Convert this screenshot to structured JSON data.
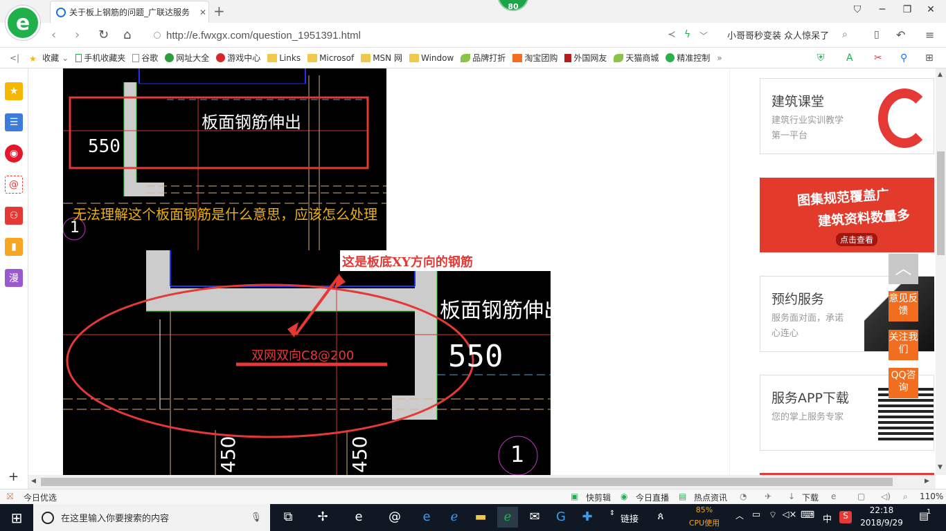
{
  "browser": {
    "tab_title": "关于板上钢筋的问题_广联达服务",
    "badge": "80",
    "url": "http://e.fwxgx.com/question_1951391.html",
    "search_hint": "小哥哥秒变装 众人惊呆了"
  },
  "bookmarks": [
    {
      "label": "收藏",
      "icon": "star-icon"
    },
    {
      "label": "手机收藏夹",
      "icon": "phone-icon"
    },
    {
      "label": "谷歌",
      "icon": "page-icon"
    },
    {
      "label": "网址大全",
      "icon": "globe-icon"
    },
    {
      "label": "游戏中心",
      "icon": "game-icon"
    },
    {
      "label": "Links",
      "icon": "folder-icon"
    },
    {
      "label": "Microsof",
      "icon": "folder-icon"
    },
    {
      "label": "MSN 网",
      "icon": "folder-icon"
    },
    {
      "label": "Window",
      "icon": "folder-icon"
    },
    {
      "label": "品牌打折",
      "icon": "leaf-icon"
    },
    {
      "label": "淘宝团购",
      "icon": "taobao-icon"
    },
    {
      "label": "外国网友",
      "icon": "flag-icon"
    },
    {
      "label": "天猫商城",
      "icon": "leaf-icon"
    },
    {
      "label": "精准控制",
      "icon": "chat-icon"
    }
  ],
  "image1": {
    "note_text": "板面钢筋伸出",
    "dim_text": "550",
    "question_text": "无法理解这个板面钢筋是什么意思，应该怎么处理",
    "circle_label": "1"
  },
  "image2": {
    "annotation": "这是板底XY方向的钢筋",
    "rebar_text": "双网双向C8@200",
    "note_text": "板面钢筋伸出",
    "dim_text": "550",
    "circle_label": "1",
    "dim_bottom_a": "450",
    "dim_bottom_b": "450"
  },
  "sidebar_cards": [
    {
      "title": "建筑课堂",
      "desc": "建筑行业实训教学第一平台"
    },
    {
      "title": "图集规范覆盖广",
      "subtitle": "建筑资料数量多",
      "button": "点击查看"
    },
    {
      "title": "预约服务",
      "desc": "服务面对面，承诺心连心"
    },
    {
      "title": "服务APP下载",
      "desc": "您的掌上服务专家"
    }
  ],
  "float_buttons": [
    {
      "label": "意见反馈"
    },
    {
      "label": "关注我们"
    },
    {
      "label": "QQ咨询"
    }
  ],
  "statusbar": {
    "left": "今日优选",
    "items": [
      "快剪辑",
      "今日直播",
      "热点资讯",
      "下载"
    ],
    "zoom": "110%"
  },
  "taskbar": {
    "search_placeholder": "在这里输入你要搜索的内容",
    "link_label": "链接",
    "cpu_percent": "85%",
    "cpu_label": "CPU使用",
    "ime": "中",
    "time": "22:18",
    "date": "2018/9/29",
    "notifications": "1"
  },
  "colors": {
    "accent": "#1fb04c",
    "orange": "#f26d1d",
    "taskbar": "#101923"
  }
}
